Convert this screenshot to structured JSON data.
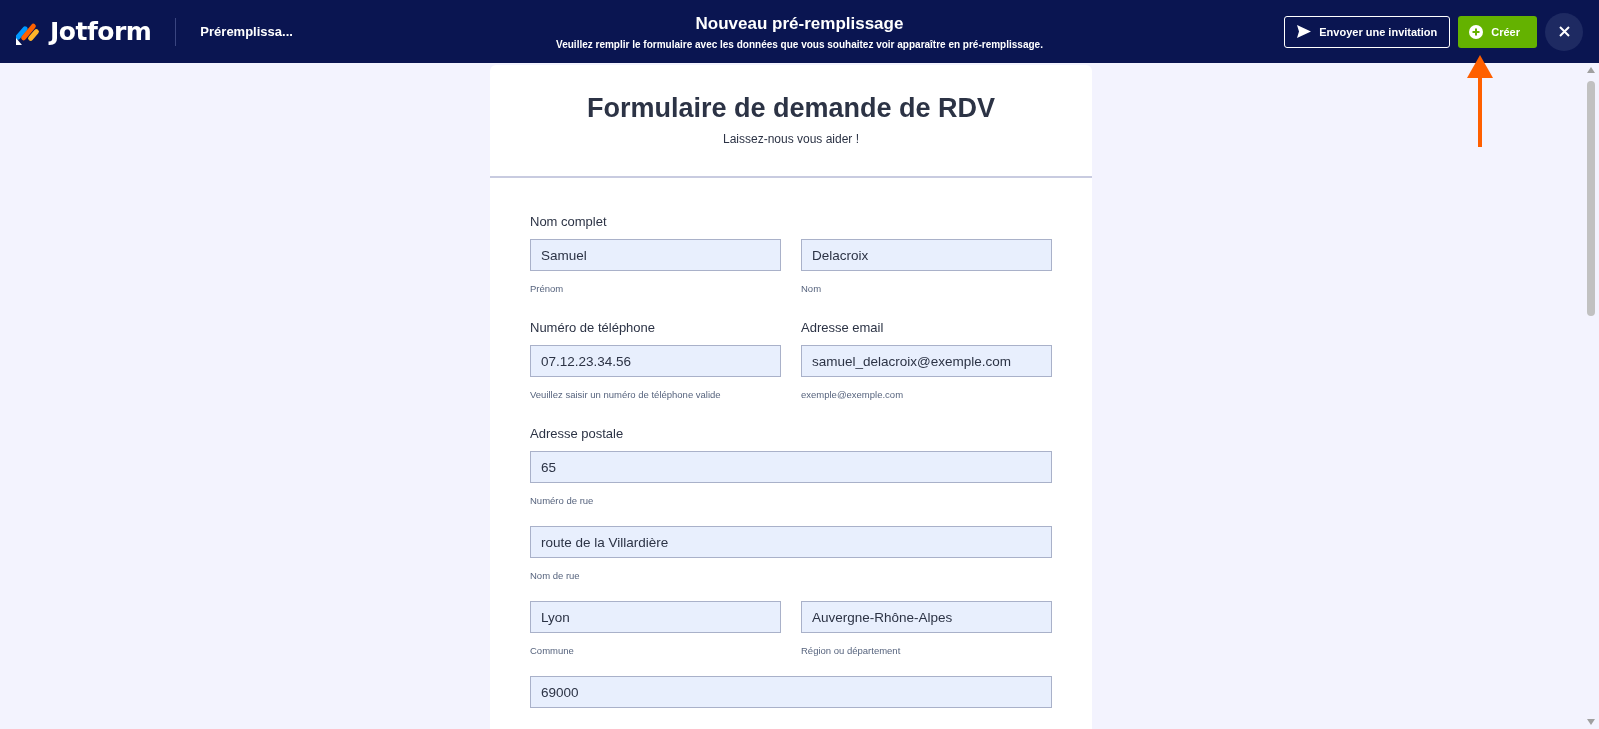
{
  "header": {
    "logo": "Jotform",
    "form_name": "Préremplissa...",
    "title": "Nouveau pré-remplissage",
    "subtitle": "Veuillez remplir le formulaire avec les données que vous souhaitez voir apparaître en pré-remplissage.",
    "buttons": [
      {
        "label": "Envoyer une invitation",
        "kind": "invite"
      },
      {
        "label": "Créer",
        "kind": "create"
      }
    ]
  },
  "form": {
    "title": "Formulaire de demande de RDV",
    "subtitle": "Laissez-nous vous aider !",
    "sections": [
      {
        "label": "Nom complet",
        "rows": [
          [
            {
              "value": "Samuel",
              "sublabel": "Prénom"
            },
            {
              "value": "Delacroix",
              "sublabel": "Nom"
            }
          ]
        ]
      },
      {
        "labels": [
          "Numéro de téléphone",
          "Adresse email"
        ],
        "rows": [
          [
            {
              "value": "07.12.23.34.56",
              "sublabel": "Veuillez saisir un numéro de téléphone valide"
            },
            {
              "value": "samuel_delacroix@exemple.com",
              "sublabel": "exemple@exemple.com"
            }
          ]
        ]
      },
      {
        "label": "Adresse postale",
        "rows": [
          [
            {
              "value": "65",
              "sublabel": "Numéro de rue"
            }
          ],
          [
            {
              "value": "route de la Villardière",
              "sublabel": "Nom de rue"
            }
          ],
          [
            {
              "value": "Lyon",
              "sublabel": "Commune"
            },
            {
              "value": "Auvergne-Rhône-Alpes",
              "sublabel": "Région ou département"
            }
          ],
          [
            {
              "value": "69000"
            }
          ]
        ]
      }
    ]
  }
}
